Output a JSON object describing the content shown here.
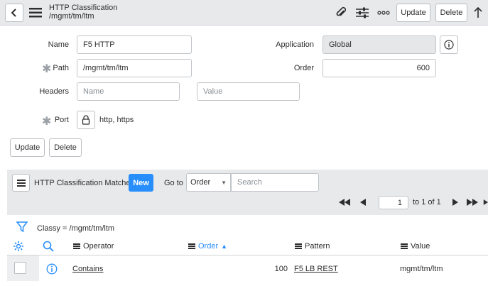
{
  "header": {
    "title": "HTTP Classification",
    "subtitle": "/mgmt/tm/ltm",
    "update_label": "Update",
    "delete_label": "Delete"
  },
  "form": {
    "name_label": "Name",
    "name_value": "F5 HTTP",
    "application_label": "Application",
    "application_value": "Global",
    "path_label": "Path",
    "path_value": "/mgmt/tm/ltm",
    "order_label": "Order",
    "order_value": "600",
    "headers_label": "Headers",
    "headers_name_placeholder": "Name",
    "headers_value_placeholder": "Value",
    "port_label": "Port",
    "port_value": "http, https",
    "update_label": "Update",
    "delete_label": "Delete"
  },
  "related_list": {
    "title": "HTTP Classification Matches",
    "new_label": "New",
    "goto_label": "Go to",
    "goto_field": "Order",
    "search_placeholder": "Search",
    "page_value": "1",
    "page_of": "to 1 of 1",
    "filter_text": "Classy = /mgmt/tm/ltm",
    "columns": {
      "operator": "Operator",
      "order": "Order",
      "pattern": "Pattern",
      "value": "Value"
    },
    "rows": [
      {
        "operator": "Contains",
        "order": "100",
        "pattern": "F5 LB REST",
        "value": "mgmt/tm/ltm"
      }
    ]
  },
  "colors": {
    "header_bg": "#e7e9eb",
    "new_button": "#278efc",
    "accent_blue": "#278efc"
  }
}
